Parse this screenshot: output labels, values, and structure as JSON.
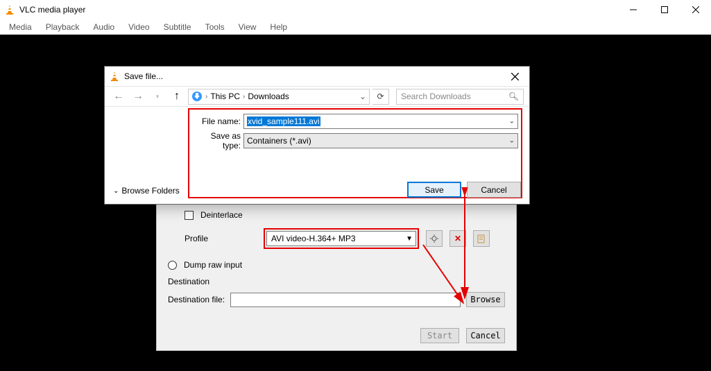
{
  "window": {
    "title": "VLC media player",
    "menu": [
      "Media",
      "Playback",
      "Audio",
      "Video",
      "Subtitle",
      "Tools",
      "View",
      "Help"
    ]
  },
  "save_dialog": {
    "title": "Save file...",
    "breadcrumb": {
      "root": "This PC",
      "folder": "Downloads"
    },
    "search_placeholder": "Search Downloads",
    "filename_label": "File name:",
    "filename_value": "xvid_sample111.avi",
    "type_label": "Save as type:",
    "type_value": "Containers (*.avi)",
    "browse_folders": "Browse Folders",
    "save_btn": "Save",
    "cancel_btn": "Cancel"
  },
  "convert": {
    "deinterlace": "Deinterlace",
    "profile_label": "Profile",
    "profile_value": "AVI video-H.364+ MP3",
    "dump_raw": "Dump raw input",
    "destination_hdr": "Destination",
    "destination_file_label": "Destination file:",
    "browse_btn": "Browse",
    "start_btn": "Start",
    "cancel_btn": "Cancel"
  }
}
